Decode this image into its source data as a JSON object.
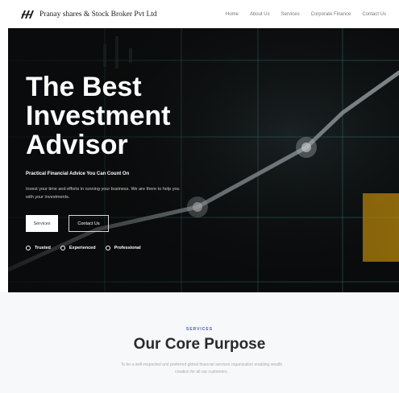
{
  "brand": {
    "name": "Pranay shares & Stock Broker Pvt Ltd",
    "logo_icon": "triple-slash-logo-icon"
  },
  "nav": {
    "items": [
      {
        "label": "Home"
      },
      {
        "label": "About Us"
      },
      {
        "label": "Services"
      },
      {
        "label": "Corporate Finance"
      },
      {
        "label": "Contact Us"
      }
    ]
  },
  "hero": {
    "title_lines": [
      "The Best",
      "Investment",
      "Advisor"
    ],
    "tagline": "Practical Financial Advice You Can Count On",
    "description": "Invest your time and efforts in running your business. We are there to help you with your investments.",
    "primary_button": "Services",
    "secondary_button": "Contact Us",
    "features": [
      {
        "label": "Trusted"
      },
      {
        "label": "Experienced"
      },
      {
        "label": "Professional"
      }
    ]
  },
  "services": {
    "eyebrow": "SERVICES",
    "title": "Our Core Purpose",
    "description": "To be a well-respected and preferred global financial services organization enabling wealth creation for all our customers."
  },
  "colors": {
    "hero_bg": "#0a0b0c",
    "accent": "#4b5fa8",
    "section_bg": "#f6f8fa"
  }
}
